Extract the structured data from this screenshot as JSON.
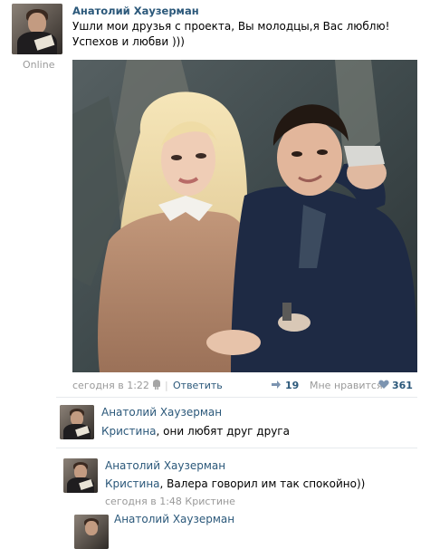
{
  "post": {
    "author": "Анатолий Хаузерман",
    "text_line1": "Ушли мои друзья с проекта, Вы молодцы,я Вас люблю!",
    "text_line2": "Успехов и любви )))",
    "status": "Online",
    "time": "сегодня в 1:22",
    "reply_link": "Ответить",
    "shares": "19",
    "like_label": "Мне нравится",
    "likes": "361"
  },
  "comments": [
    {
      "author": "Анатолий Хаузерман",
      "addressee": "Кристина",
      "text": ", они любят друг друга"
    },
    {
      "author": "Анатолий Хаузерман",
      "addressee": "Кристина",
      "text": ", Валера говорил им так спокойно))",
      "time": "сегодня в 1:48",
      "to": "Кристине"
    },
    {
      "author": "Анатолий Хаузерман"
    }
  ],
  "colors": {
    "link": "#2b587a",
    "muted": "#999999",
    "heart": "#7c94b0"
  }
}
